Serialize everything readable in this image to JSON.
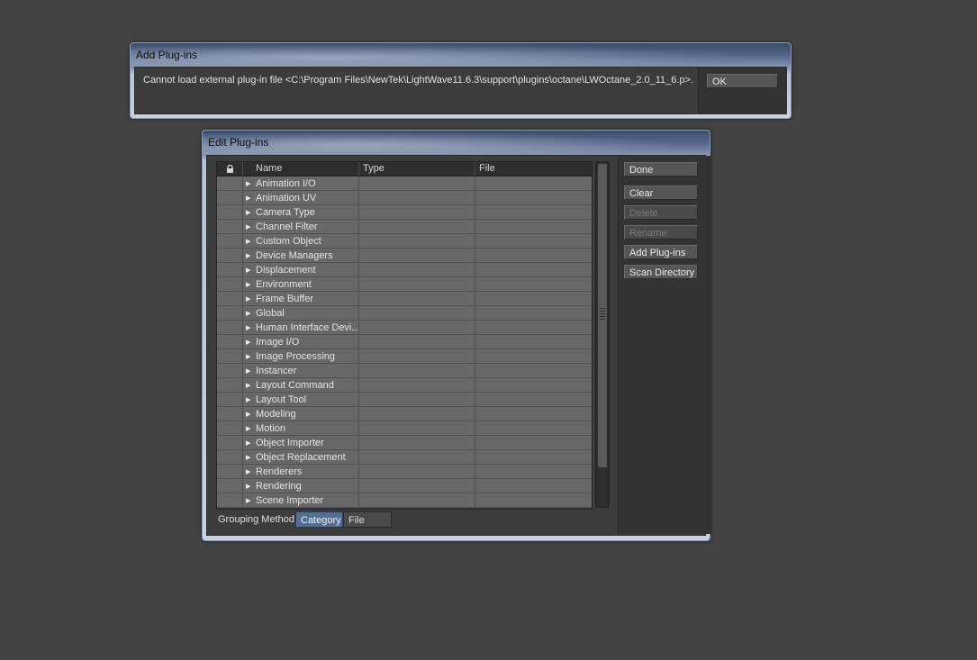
{
  "add_dialog": {
    "title": "Add Plug-ins",
    "message": "Cannot load external plug-in file <C:\\Program Files\\NewTek\\LightWave11.6.3\\support\\plugins\\octane\\LWOctane_2.0_11_6.p>.",
    "ok_label": "OK"
  },
  "edit_dialog": {
    "title": "Edit Plug-ins",
    "columns": {
      "lock": "lock-icon",
      "name": "Name",
      "type": "Type",
      "file": "File"
    },
    "rows": [
      "Animation I/O",
      "Animation UV",
      "Camera Type",
      "Channel Filter",
      "Custom Object",
      "Device Managers",
      "Displacement",
      "Environment",
      "Frame Buffer",
      "Global",
      "Human Interface Devi...",
      "Image I/O",
      "Image Processing",
      "Instancer",
      "Layout Command",
      "Layout Tool",
      "Modeling",
      "Motion",
      "Object Importer",
      "Object Replacement",
      "Renderers",
      "Rendering",
      "Scene Importer"
    ],
    "buttons": {
      "done": "Done",
      "clear": "Clear",
      "delete": "Delete",
      "rename": "Rename",
      "add_plugins": "Add Plug-ins",
      "scan_directory": "Scan Directory"
    },
    "grouping": {
      "label": "Grouping Method",
      "options": [
        "Category",
        "File"
      ],
      "selected": "Category"
    }
  },
  "colors": {
    "background": "#424242",
    "title_bar": "#c9d2e0",
    "selected_segment": "#4f6f94"
  }
}
